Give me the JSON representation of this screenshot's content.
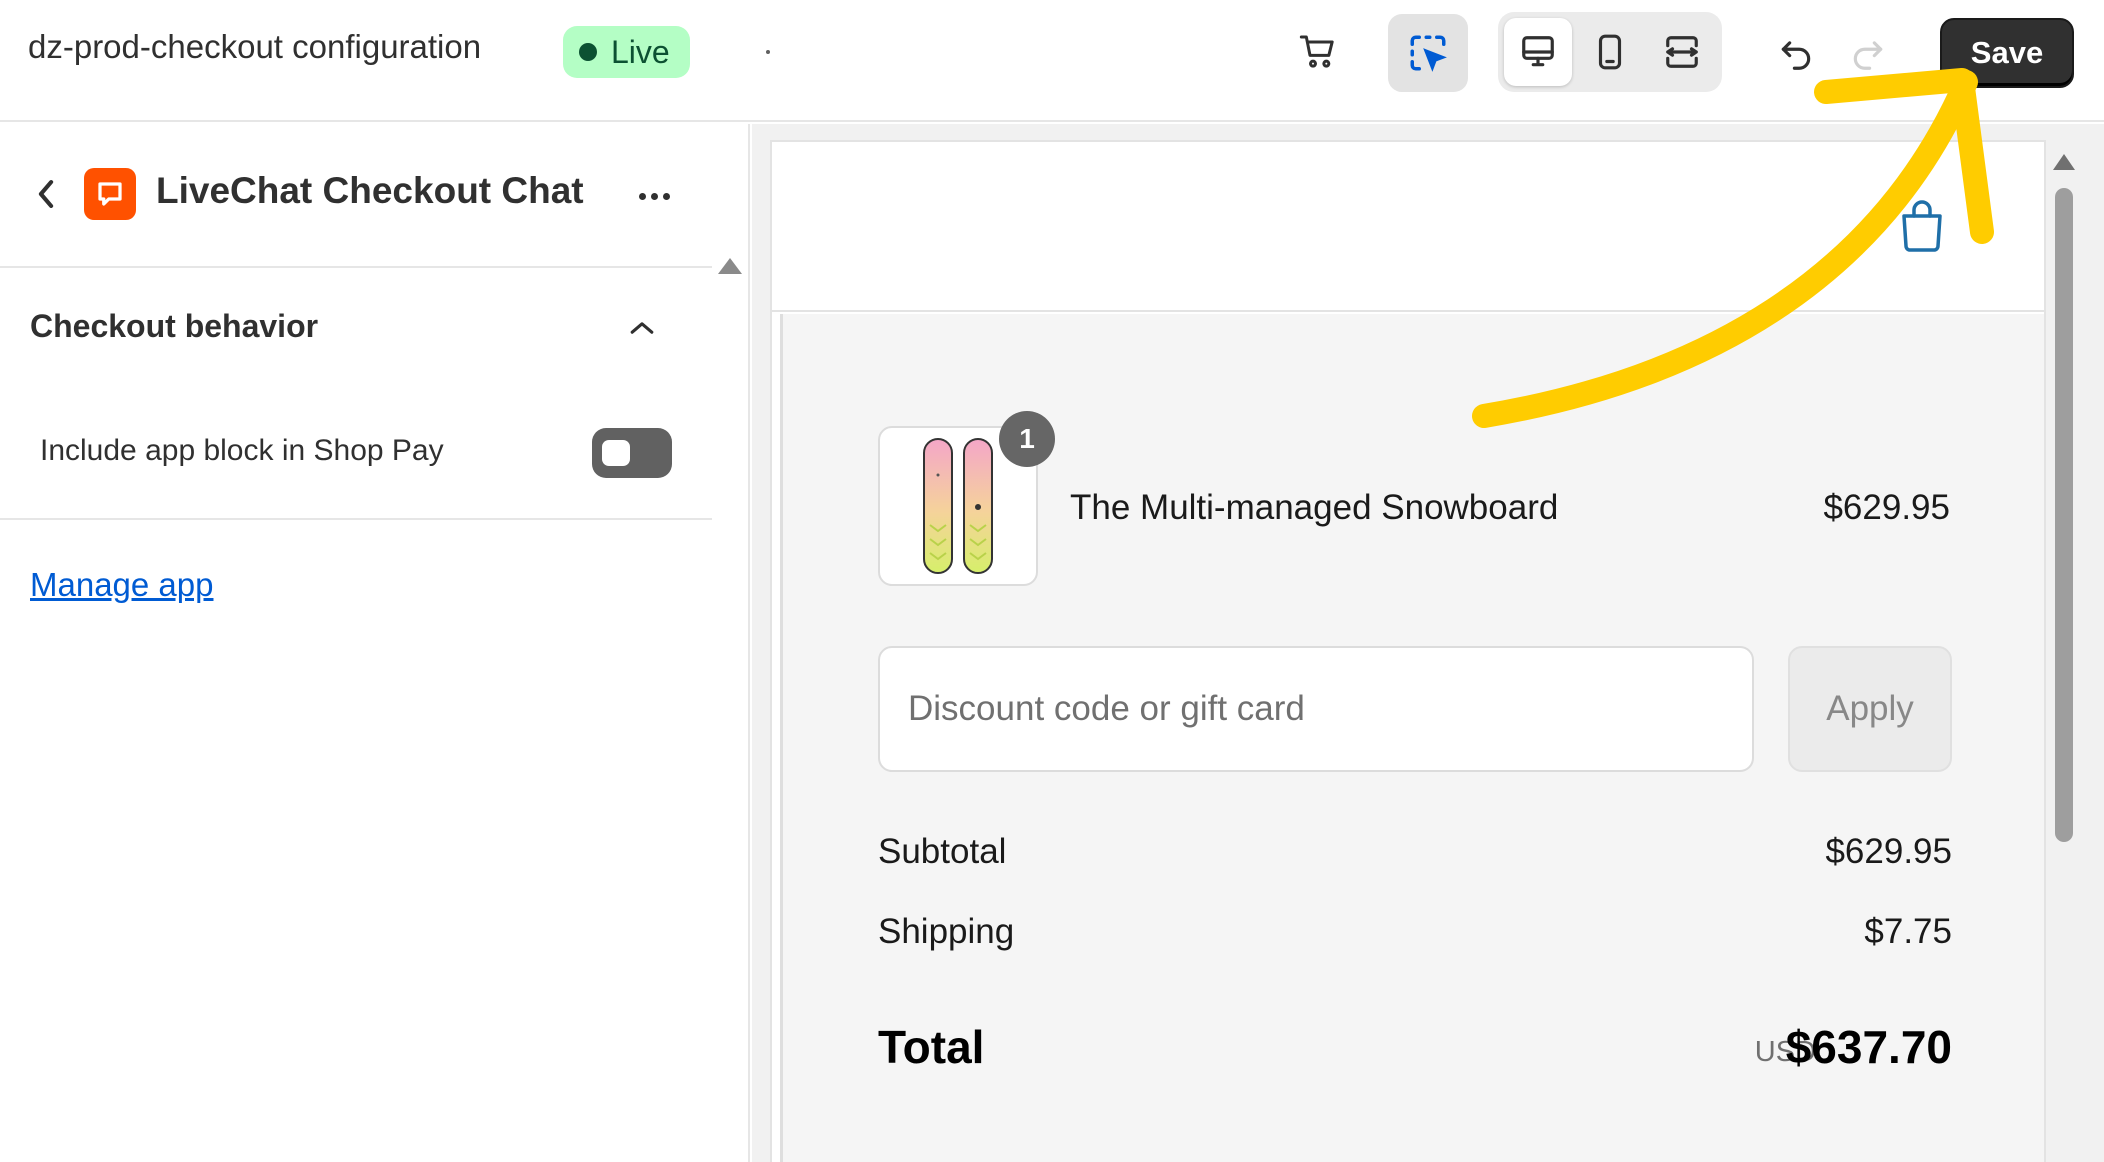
{
  "header": {
    "title": "dz-prod-checkout configuration",
    "status": "Live",
    "save_label": "Save",
    "icons": [
      "cart-icon",
      "select-icon",
      "desktop-icon",
      "mobile-icon",
      "full-width-icon",
      "undo-icon",
      "redo-icon"
    ]
  },
  "sidebar": {
    "app_name": "LiveChat Checkout Chat",
    "app_icon_color": "#ff5100",
    "section": {
      "title": "Checkout behavior",
      "setting_label": "Include app block in Shop Pay",
      "toggle_on": false
    },
    "manage_link": "Manage app"
  },
  "preview": {
    "product": {
      "name": "The Multi-managed Snowboard",
      "price": "$629.95",
      "quantity": "1"
    },
    "discount": {
      "placeholder": "Discount code or gift card",
      "apply_label": "Apply"
    },
    "summary": {
      "subtotal_label": "Subtotal",
      "subtotal_value": "$629.95",
      "shipping_label": "Shipping",
      "shipping_value": "$7.75",
      "total_label": "Total",
      "currency": "USD",
      "total_value": "$637.70"
    }
  },
  "colors": {
    "live_badge_bg": "#b4fec5",
    "save_button_bg": "#303030",
    "link": "#005bd3",
    "annotation_arrow": "#ffcc00"
  }
}
